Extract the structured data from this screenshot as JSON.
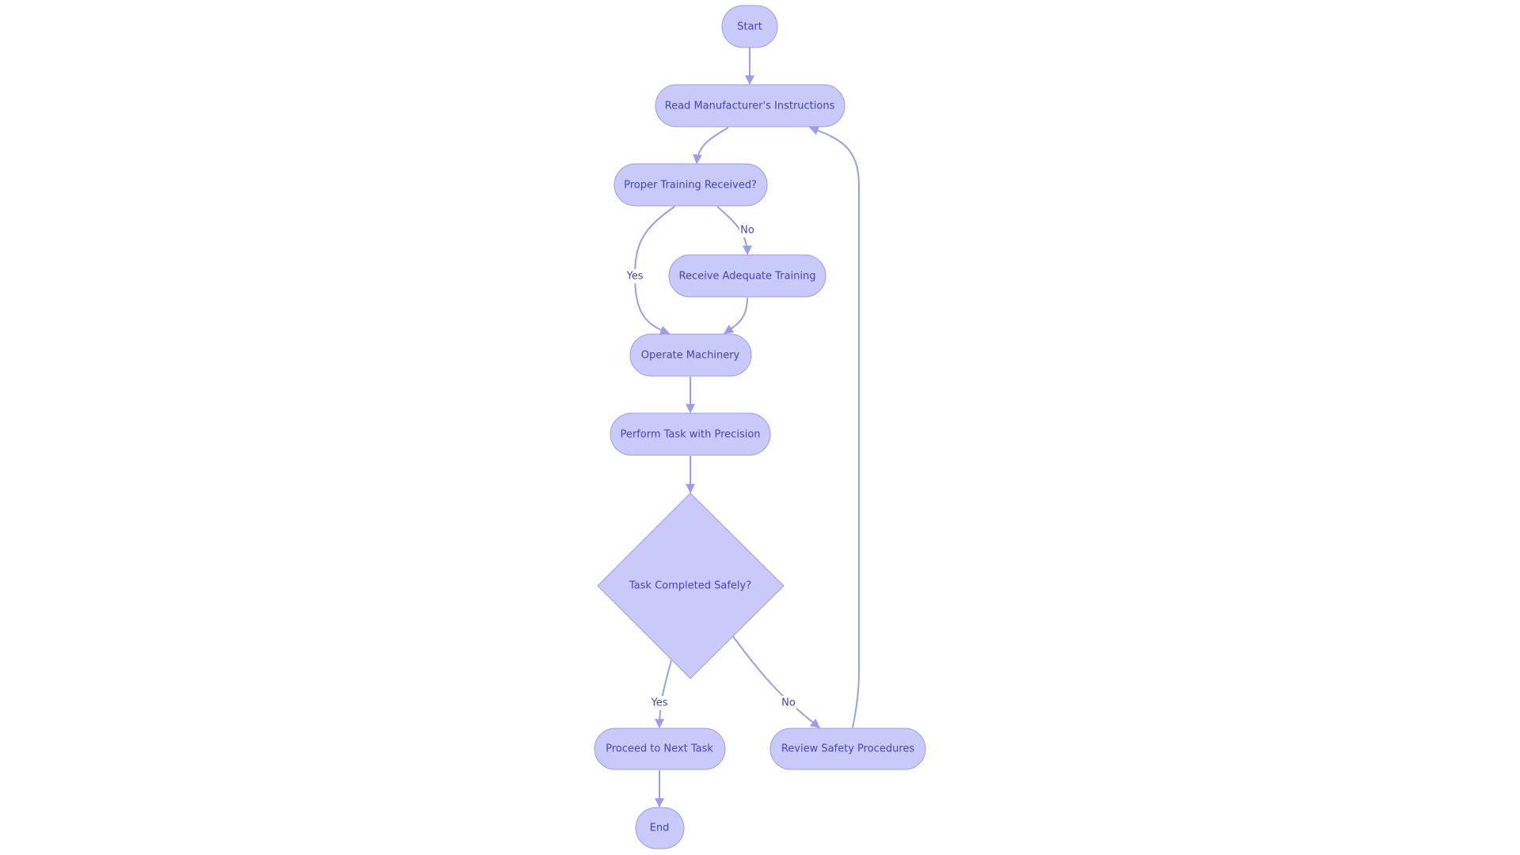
{
  "diagram": {
    "type": "flowchart",
    "colors": {
      "node_fill": "#c9cafa",
      "node_stroke": "#9a9ce6",
      "text": "#4446b8",
      "edge": "#9b9de8"
    },
    "nodes": [
      {
        "id": "start",
        "label": "Start",
        "shape": "stadium"
      },
      {
        "id": "read",
        "label": "Read Manufacturer's Instructions",
        "shape": "stadium"
      },
      {
        "id": "training",
        "label": "Proper Training Received?",
        "shape": "stadium"
      },
      {
        "id": "receive",
        "label": "Receive Adequate Training",
        "shape": "stadium"
      },
      {
        "id": "operate",
        "label": "Operate Machinery",
        "shape": "stadium"
      },
      {
        "id": "perform",
        "label": "Perform Task with Precision",
        "shape": "stadium"
      },
      {
        "id": "safe",
        "label": "Task Completed Safely?",
        "shape": "diamond"
      },
      {
        "id": "proceed",
        "label": "Proceed to Next Task",
        "shape": "stadium"
      },
      {
        "id": "review",
        "label": "Review Safety Procedures",
        "shape": "stadium"
      },
      {
        "id": "end",
        "label": "End",
        "shape": "stadium"
      }
    ],
    "edges": [
      {
        "from": "start",
        "to": "read",
        "label": ""
      },
      {
        "from": "read",
        "to": "training",
        "label": ""
      },
      {
        "from": "training",
        "to": "operate",
        "label": "Yes"
      },
      {
        "from": "training",
        "to": "receive",
        "label": "No"
      },
      {
        "from": "receive",
        "to": "operate",
        "label": ""
      },
      {
        "from": "operate",
        "to": "perform",
        "label": ""
      },
      {
        "from": "perform",
        "to": "safe",
        "label": ""
      },
      {
        "from": "safe",
        "to": "proceed",
        "label": "Yes"
      },
      {
        "from": "safe",
        "to": "review",
        "label": "No"
      },
      {
        "from": "proceed",
        "to": "end",
        "label": ""
      },
      {
        "from": "review",
        "to": "read",
        "label": ""
      }
    ]
  }
}
